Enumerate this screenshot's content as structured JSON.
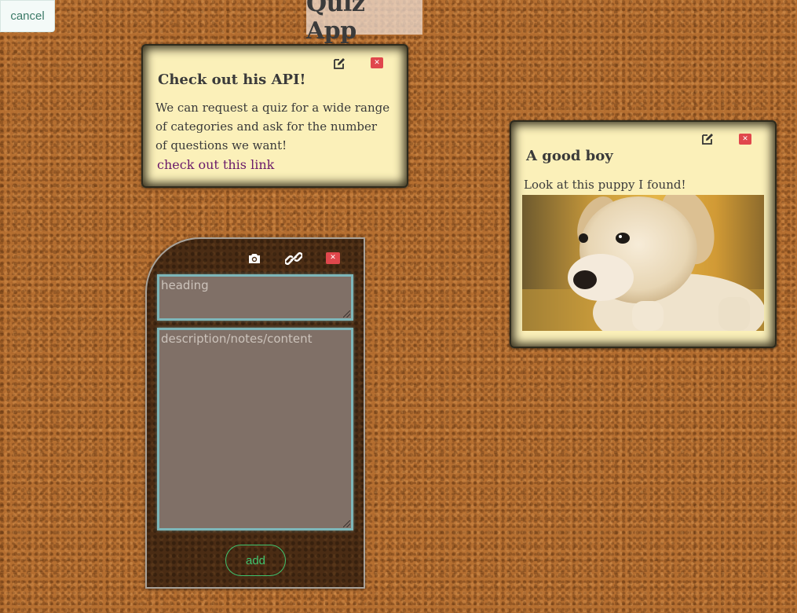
{
  "app": {
    "title": "Quiz App",
    "cancel_label": "cancel"
  },
  "notes": [
    {
      "heading": "Check out his API!",
      "description": "We can request a quiz for a wide range of categories and ask for the number of questions we want!",
      "link_text": "check out this link",
      "edit_icon": "edit-icon",
      "close_icon": "close-icon"
    },
    {
      "heading": "A good boy",
      "description": "Look at this puppy I found!",
      "image": "puppy-photo",
      "edit_icon": "edit-icon",
      "close_icon": "close-icon"
    }
  ],
  "form": {
    "heading_placeholder": "heading",
    "description_placeholder": "description/notes/content",
    "add_label": "add",
    "icons": [
      "camera-icon",
      "link-icon",
      "close-icon"
    ]
  },
  "colors": {
    "note_background": "#fbf0b9",
    "close_red": "#e0474c",
    "add_green": "#3fc46e",
    "field_border": "#7db6b9",
    "link_purple": "#6a1a6a"
  }
}
